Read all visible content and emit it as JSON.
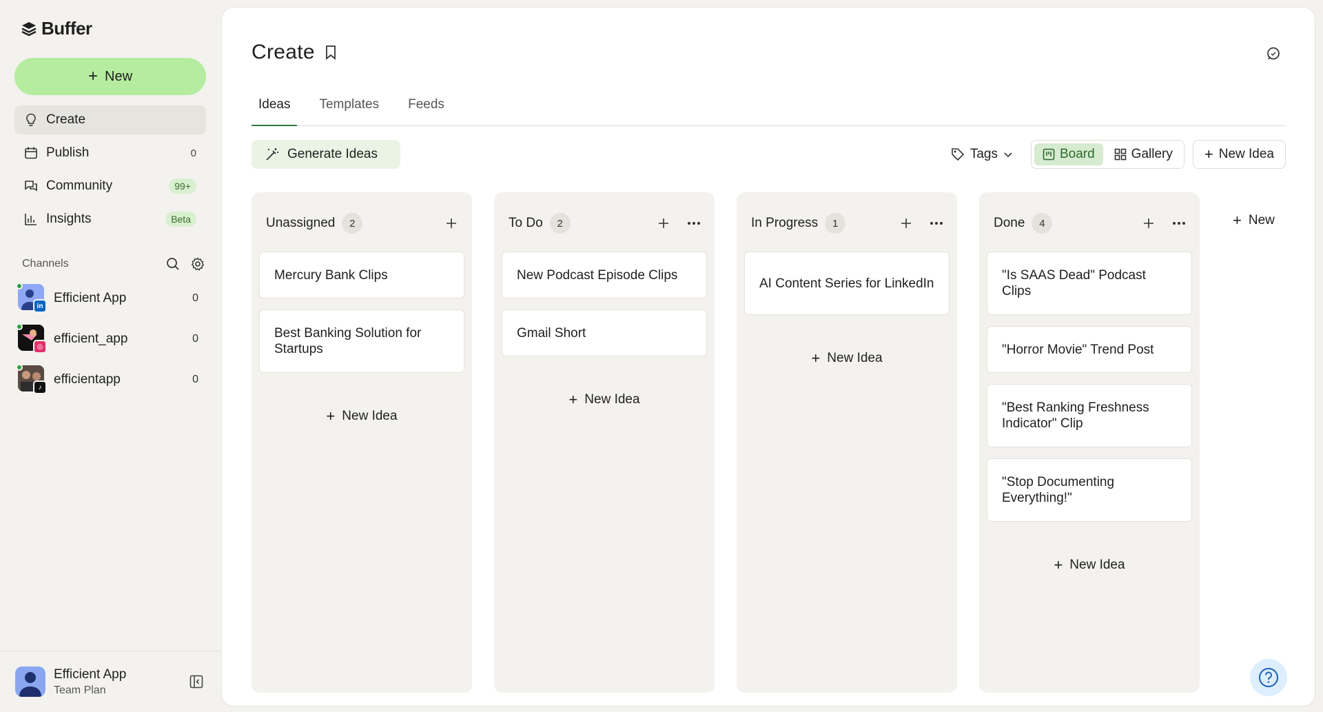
{
  "app": {
    "logo_text": "Buffer",
    "new_button": "New"
  },
  "nav": {
    "items": [
      {
        "label": "Create",
        "count": "",
        "badge": ""
      },
      {
        "label": "Publish",
        "count": "0",
        "badge": ""
      },
      {
        "label": "Community",
        "count": "",
        "badge": "99+"
      },
      {
        "label": "Insights",
        "count": "",
        "badge": "Beta"
      }
    ]
  },
  "channels": {
    "heading": "Channels",
    "items": [
      {
        "name": "Efficient App",
        "count": "0",
        "network": "linkedin-icon",
        "network_color": "#0a66c2"
      },
      {
        "name": "efficient_app",
        "count": "0",
        "network": "instagram-icon",
        "network_color": "#e1306c"
      },
      {
        "name": "efficientapp",
        "count": "0",
        "network": "tiktok-icon",
        "network_color": "#111111"
      }
    ]
  },
  "account": {
    "name": "Efficient App",
    "plan": "Team Plan"
  },
  "page": {
    "title": "Create",
    "tabs": [
      {
        "label": "Ideas",
        "active": true
      },
      {
        "label": "Templates",
        "active": false
      },
      {
        "label": "Feeds",
        "active": false
      }
    ],
    "generate_button": "Generate Ideas",
    "tags_label": "Tags",
    "view_board": "Board",
    "view_gallery": "Gallery",
    "new_idea_button": "New Idea",
    "new_column": "New"
  },
  "board": {
    "columns": [
      {
        "title": "Unassigned",
        "count": "2",
        "new_idea": "New Idea",
        "cards": [
          "Mercury Bank Clips",
          "Best Banking Solution for Startups"
        ]
      },
      {
        "title": "To Do",
        "count": "2",
        "new_idea": "New Idea",
        "cards": [
          "New Podcast Episode Clips",
          "Gmail Short"
        ]
      },
      {
        "title": "In Progress",
        "count": "1",
        "new_idea": "New Idea",
        "cards": [
          "AI Content Series for LinkedIn"
        ]
      },
      {
        "title": "Done",
        "count": "4",
        "new_idea": "New Idea",
        "cards": [
          "\"Is SAAS Dead\" Podcast Clips",
          "\"Horror Movie\" Trend Post",
          "\"Best Ranking Freshness Indicator\" Clip",
          "\"Stop Documenting Everything!\""
        ]
      }
    ]
  },
  "colors": {
    "accent": "#b5ec9f",
    "active_tab": "#2f7a3f"
  }
}
